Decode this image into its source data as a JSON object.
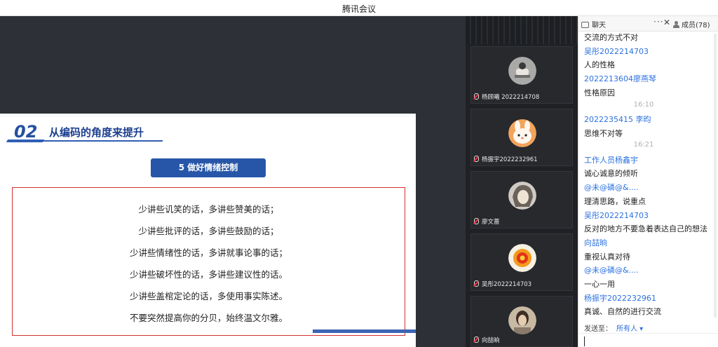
{
  "window": {
    "title": "腾讯会议"
  },
  "slide": {
    "section_number": "02",
    "section_title": "从编码的角度来提升",
    "badge": "5  做好情绪控制",
    "lines": [
      "少讲些讥笑的话，多讲些赞美的话；",
      "少讲些批评的话，多讲些鼓励的话；",
      "少讲些情绪性的话，多讲就事论事的话；",
      "少讲些破坏性的话，多讲些建议性的话。",
      "少讲些盖棺定论的话，多使用事实陈述。",
      "不要突然提高你的分贝，始终温文尔雅。"
    ]
  },
  "participants": [
    {
      "name": "杨顾曦 2022214708",
      "avatar": "cartoon-figure"
    },
    {
      "name": "杨振宇2022232961",
      "avatar": "cute-bunny"
    },
    {
      "name": "廖文蔷",
      "avatar": "anime-portrait"
    },
    {
      "name": "吴彤2022214703",
      "avatar": "orange-flower"
    },
    {
      "name": "向喆晌",
      "avatar": "person-photo"
    }
  ],
  "chat": {
    "tab_chat": "聊天",
    "more": "···",
    "close": "✕",
    "tab_members": "成员(78)",
    "messages": [
      {
        "kind": "dark",
        "text": "交流的方式不对"
      },
      {
        "kind": "blue",
        "text": "吴彤2022214703"
      },
      {
        "kind": "dark",
        "text": "人的性格"
      },
      {
        "kind": "blue",
        "text": "2022213604廖燕琴"
      },
      {
        "kind": "dark",
        "text": "性格原因"
      },
      {
        "kind": "time",
        "text": "16:10"
      },
      {
        "kind": "blue",
        "text": "2022235415 李昀"
      },
      {
        "kind": "dark",
        "text": "思维不对等"
      },
      {
        "kind": "time",
        "text": "16:21"
      },
      {
        "kind": "blue",
        "text": "工作人员杨鑫宇"
      },
      {
        "kind": "dark",
        "text": "诚心诚意的倾听"
      },
      {
        "kind": "blue",
        "text": "@未@磷@&...."
      },
      {
        "kind": "dark",
        "text": "理清思路，说重点"
      },
      {
        "kind": "blue",
        "text": "吴彤2022214703"
      },
      {
        "kind": "dark",
        "text": "反对的地方不要急着表达自己的想法"
      },
      {
        "kind": "blue",
        "text": "向喆晌"
      },
      {
        "kind": "dark",
        "text": "重视认真对待"
      },
      {
        "kind": "blue",
        "text": "@未@磷@&...."
      },
      {
        "kind": "dark",
        "text": "一心一用"
      },
      {
        "kind": "blue",
        "text": "杨振宇2022232961"
      },
      {
        "kind": "dark",
        "text": "真诚、自然的进行交流"
      }
    ],
    "send_to_label": "发送至：",
    "send_to_value": "所有人 ▾",
    "input_value": ""
  }
}
